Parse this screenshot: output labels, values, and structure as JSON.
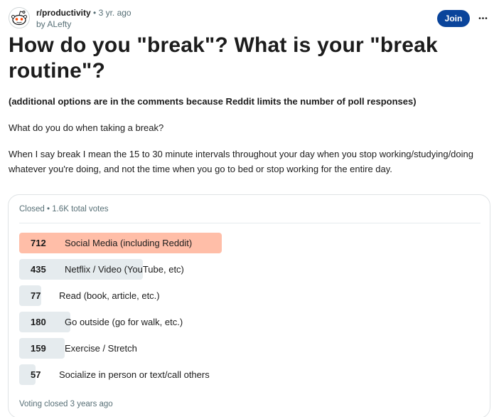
{
  "post": {
    "subreddit": "r/productivity",
    "age": "• 3 yr. ago",
    "byline": "by ALefty",
    "join_label": "Join",
    "more_label": "•••",
    "title": "How do you \"break\"? What is your \"break routine\"?",
    "note": "(additional options are in the comments because Reddit limits the number of poll responses)",
    "question": "What do you do when taking a break?",
    "explanation": "When I say break I mean the 15 to 30 minute intervals throughout your day when you stop working/studying/doing whatever you're doing, and not the time when you go to bed or stop working for the entire day."
  },
  "poll": {
    "status": "Closed • 1.6K total votes",
    "footer": "Voting closed 3 years ago",
    "winner_color": "#ffbea8",
    "bar_color": "#e5ebee",
    "options": [
      {
        "count": "712",
        "label": "Social Media (including Reddit)",
        "votes": 712,
        "winner": true
      },
      {
        "count": "435",
        "label": "Netflix / Video (YouTube, etc)",
        "votes": 435,
        "winner": false
      },
      {
        "count": "77",
        "label": "Read (book, article, etc.)",
        "votes": 77,
        "winner": false
      },
      {
        "count": "180",
        "label": "Go outside (go for walk, etc.)",
        "votes": 180,
        "winner": false
      },
      {
        "count": "159",
        "label": "Exercise / Stretch",
        "votes": 159,
        "winner": false
      },
      {
        "count": "57",
        "label": "Socialize in person or text/call others",
        "votes": 57,
        "winner": false
      }
    ]
  },
  "accent": {
    "join_button": "#0a449b",
    "meta_text": "#576f76"
  }
}
